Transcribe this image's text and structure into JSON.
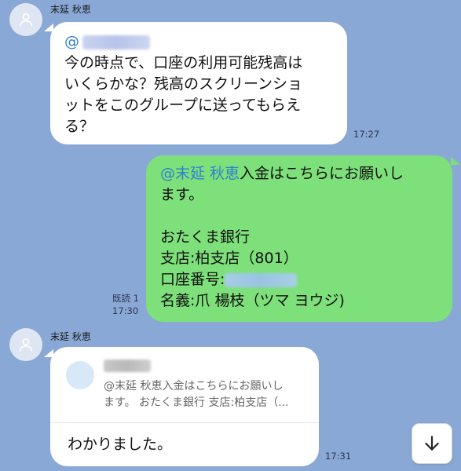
{
  "messages": [
    {
      "sender": "末延 秋恵",
      "mention_prefix": "@",
      "text": "今の時点で、口座の利用可能残高は\nいくらかな？残高のスクリーンショ\nットをこのグループに送ってもらえ\nる？",
      "time": "17:27"
    },
    {
      "mention": "@末延 秋恵",
      "text_line1_rest": "入金はこちらにお願いし",
      "text_rest": "ます。\n\nおたくま銀行\n支店:柏支店（801）",
      "account_label": "口座番号:",
      "holder": "名義:爪 楊枝（ツマ ヨウジ)",
      "read_status": "既読 1",
      "time": "17:30"
    },
    {
      "sender": "末延 秋恵",
      "quote_text": "@末延 秋恵入金はこちらにお願いし\nます。 おたくま銀行 支店:柏支店（...",
      "text": "わかりました。",
      "time": "17:31"
    }
  ],
  "icons": {
    "avatar": "person-icon",
    "scroll": "arrow-down-icon"
  },
  "colors": {
    "background": "#8aa8d6",
    "outgoing_bubble": "#7ee07a",
    "incoming_bubble": "#ffffff",
    "mention": "#2e7fd1"
  }
}
